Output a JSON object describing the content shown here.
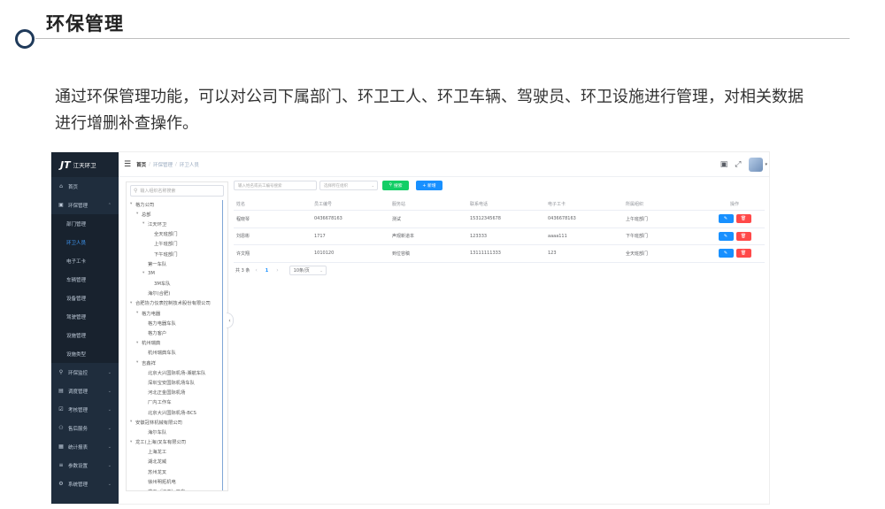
{
  "slide": {
    "title": "环保管理",
    "description": "通过环保管理功能，可以对公司下属部门、环卫工人、环卫车辆、驾驶员、环卫设施进行管理，对相关数据进行增删补查操作。"
  },
  "app": {
    "logo_mark": "JT",
    "logo_name": "江天环卫",
    "sidebar": {
      "home": {
        "icon": "⌂",
        "label": "首页"
      },
      "env_group": {
        "icon": "▣",
        "label": "环保管理",
        "expanded": true
      },
      "env_sub": [
        "部门管理",
        "环卫人员",
        "电子工卡",
        "车辆管理",
        "设备管理",
        "驾驶管理",
        "设施管理",
        "设施类型"
      ],
      "active_sub": "环卫人员",
      "groups": [
        {
          "icon": "⚲",
          "label": "环保监控"
        },
        {
          "icon": "▤",
          "label": "调度管理"
        },
        {
          "icon": "☑",
          "label": "考核管理"
        },
        {
          "icon": "⚇",
          "label": "售后服务"
        },
        {
          "icon": "▦",
          "label": "统计报表"
        },
        {
          "icon": "≡",
          "label": "参数设置"
        },
        {
          "icon": "⚙",
          "label": "系统管理"
        }
      ]
    },
    "breadcrumb": [
      "首页",
      "环保管理",
      "环卫人员"
    ],
    "top_icons": [
      "message-icon",
      "fullscreen-icon"
    ],
    "tree": {
      "search_placeholder": "输入组织名称搜索",
      "nodes": [
        {
          "label": "格力公司",
          "level": 0,
          "caret": "▾"
        },
        {
          "label": "总部",
          "level": 1,
          "caret": "▾"
        },
        {
          "label": "江天环卫",
          "level": 2,
          "caret": "▾"
        },
        {
          "label": "全天班部门",
          "level": 3,
          "caret": ""
        },
        {
          "label": "上午班部门",
          "level": 3,
          "caret": ""
        },
        {
          "label": "下午班部门",
          "level": 3,
          "caret": ""
        },
        {
          "label": "第一车队",
          "level": 2,
          "caret": ""
        },
        {
          "label": "3M",
          "level": 2,
          "caret": "▾"
        },
        {
          "label": "3M车队",
          "level": 3,
          "caret": ""
        },
        {
          "label": "海尔(合肥)",
          "level": 2,
          "caret": ""
        },
        {
          "label": "合肥协力仪表控制技术股份有限公司",
          "level": 0,
          "caret": "▾"
        },
        {
          "label": "格力电器",
          "level": 1,
          "caret": "▾"
        },
        {
          "label": "格力电器车队",
          "level": 2,
          "caret": ""
        },
        {
          "label": "格力客户",
          "level": 2,
          "caret": ""
        },
        {
          "label": "杭州瑞典",
          "level": 1,
          "caret": "▾"
        },
        {
          "label": "杭州瑞典车队",
          "level": 2,
          "caret": ""
        },
        {
          "label": "吉鑫祥",
          "level": 1,
          "caret": "▾"
        },
        {
          "label": "北京大兴国际机场-湘航车队",
          "level": 2,
          "caret": ""
        },
        {
          "label": "深圳宝安国际机场车队",
          "level": 2,
          "caret": ""
        },
        {
          "label": "河北正金国际机场",
          "level": 2,
          "caret": ""
        },
        {
          "label": "厂内工作车",
          "level": 2,
          "caret": ""
        },
        {
          "label": "北京大兴国际机场-BCS",
          "level": 2,
          "caret": ""
        },
        {
          "label": "安徽冠林机械有限公司",
          "level": 0,
          "caret": "▾"
        },
        {
          "label": "海尔车队",
          "level": 2,
          "caret": ""
        },
        {
          "label": "龙工(上海)叉车有限公司",
          "level": 0,
          "caret": "▾"
        },
        {
          "label": "上海龙工",
          "level": 2,
          "caret": ""
        },
        {
          "label": "湖北龙威",
          "level": 2,
          "caret": ""
        },
        {
          "label": "苏州龙叉",
          "level": 2,
          "caret": ""
        },
        {
          "label": "徐州明拓机电",
          "level": 2,
          "caret": ""
        },
        {
          "label": "龙工（江西）叉车",
          "level": 2,
          "caret": ""
        }
      ]
    },
    "filters": {
      "name_placeholder": "输入姓名或员工编号搜索",
      "org_placeholder": "选择所在组织",
      "search_label": "搜索",
      "search_icon": "search-icon",
      "add_label": "+ 新增"
    },
    "table": {
      "headers": [
        "姓名",
        "员工编号",
        "服务站",
        "联系电话",
        "电子工卡",
        "所属组织",
        "操作"
      ],
      "rows": [
        [
          "程晓琴",
          "0436678163",
          "测试",
          "15312345678",
          "0436678163",
          "上午班部门"
        ],
        [
          "刘恩彬",
          "1717",
          "声观新道本",
          "123333",
          "aaaa111",
          "下午班部门"
        ],
        [
          "许文翔",
          "1010120",
          "到位容稿",
          "13111111333",
          "123",
          "全天班部门"
        ]
      ],
      "edit_icon": "✎",
      "delete_icon": "🗑"
    },
    "pagination": {
      "total": "共 3 条",
      "current": "1",
      "page_size": "10条/页"
    }
  }
}
